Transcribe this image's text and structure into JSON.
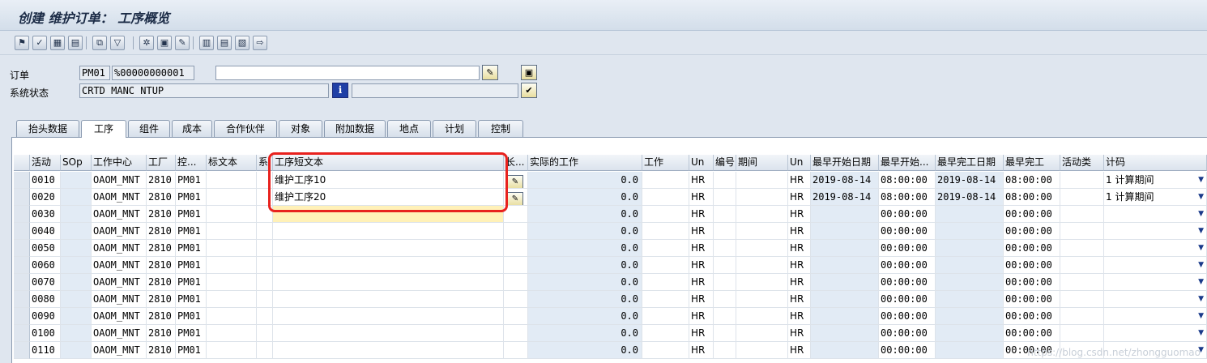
{
  "window": {
    "title": "创建 维护订单： 工序概览"
  },
  "toolbar": {
    "buttons": [
      {
        "name": "header-flag-icon",
        "glyph": "⚑"
      },
      {
        "name": "check-icon",
        "glyph": "✓"
      },
      {
        "name": "table-icon",
        "glyph": "▦"
      },
      {
        "name": "calendar-icon",
        "glyph": "▤"
      },
      {
        "name": "hierarchy-icon",
        "glyph": "⧉"
      },
      {
        "name": "filter-icon",
        "glyph": "▽"
      },
      {
        "name": "network-icon",
        "glyph": "✲"
      },
      {
        "name": "document-icon",
        "glyph": "▣"
      },
      {
        "name": "pencil-icon",
        "glyph": "✎"
      },
      {
        "name": "clipboard-icon",
        "glyph": "▥"
      },
      {
        "name": "print-icon",
        "glyph": "▤"
      },
      {
        "name": "save-list-icon",
        "glyph": "▧"
      },
      {
        "name": "forward-icon",
        "glyph": "⇨"
      }
    ]
  },
  "header": {
    "order_label": "订单",
    "order_type": "PM01",
    "order_number": "%00000000001",
    "order_desc": "",
    "status_label": "系统状态",
    "status_value": "CRTD MANC NTUP",
    "status_extra": ""
  },
  "tabs": [
    "抬头数据",
    "工序",
    "组件",
    "成本",
    "合作伙伴",
    "对象",
    "附加数据",
    "地点",
    "计划",
    "控制"
  ],
  "active_tab": "工序",
  "grid": {
    "columns": [
      "活动",
      "SOp",
      "工作中心",
      "工厂",
      "控...",
      "标文本",
      "系",
      "工序短文本",
      "长...",
      "实际的工作",
      "工作",
      "Un",
      "编号",
      "期间",
      "Un",
      "最早开始日期",
      "最早开始...",
      "最早完工日期",
      "最早完工",
      "活动类",
      "计码"
    ],
    "rows": [
      {
        "act": "0010",
        "wc": "OAOM_MNT",
        "plant": "2810",
        "ctrl": "PM01",
        "text": "维护工序10",
        "longtext": true,
        "actual": "0.0",
        "un1": "HR",
        "un2": "HR",
        "es_date": "2019-08-14",
        "es_time": "08:00:00",
        "ef_date": "2019-08-14",
        "ef_time": "08:00:00",
        "calc": "1 计算期间"
      },
      {
        "act": "0020",
        "wc": "OAOM_MNT",
        "plant": "2810",
        "ctrl": "PM01",
        "text": "维护工序20",
        "longtext": true,
        "actual": "0.0",
        "un1": "HR",
        "un2": "HR",
        "es_date": "2019-08-14",
        "es_time": "08:00:00",
        "ef_date": "2019-08-14",
        "ef_time": "08:00:00",
        "calc": "1 计算期间"
      },
      {
        "act": "0030",
        "wc": "OAOM_MNT",
        "plant": "2810",
        "ctrl": "PM01",
        "text": "",
        "longtext": false,
        "actual": "0.0",
        "un1": "HR",
        "un2": "HR",
        "es_date": "",
        "es_time": "00:00:00",
        "ef_date": "",
        "ef_time": "00:00:00",
        "calc": ""
      },
      {
        "act": "0040",
        "wc": "OAOM_MNT",
        "plant": "2810",
        "ctrl": "PM01",
        "text": "",
        "longtext": false,
        "actual": "0.0",
        "un1": "HR",
        "un2": "HR",
        "es_date": "",
        "es_time": "00:00:00",
        "ef_date": "",
        "ef_time": "00:00:00",
        "calc": ""
      },
      {
        "act": "0050",
        "wc": "OAOM_MNT",
        "plant": "2810",
        "ctrl": "PM01",
        "text": "",
        "longtext": false,
        "actual": "0.0",
        "un1": "HR",
        "un2": "HR",
        "es_date": "",
        "es_time": "00:00:00",
        "ef_date": "",
        "ef_time": "00:00:00",
        "calc": ""
      },
      {
        "act": "0060",
        "wc": "OAOM_MNT",
        "plant": "2810",
        "ctrl": "PM01",
        "text": "",
        "longtext": false,
        "actual": "0.0",
        "un1": "HR",
        "un2": "HR",
        "es_date": "",
        "es_time": "00:00:00",
        "ef_date": "",
        "ef_time": "00:00:00",
        "calc": ""
      },
      {
        "act": "0070",
        "wc": "OAOM_MNT",
        "plant": "2810",
        "ctrl": "PM01",
        "text": "",
        "longtext": false,
        "actual": "0.0",
        "un1": "HR",
        "un2": "HR",
        "es_date": "",
        "es_time": "00:00:00",
        "ef_date": "",
        "ef_time": "00:00:00",
        "calc": ""
      },
      {
        "act": "0080",
        "wc": "OAOM_MNT",
        "plant": "2810",
        "ctrl": "PM01",
        "text": "",
        "longtext": false,
        "actual": "0.0",
        "un1": "HR",
        "un2": "HR",
        "es_date": "",
        "es_time": "00:00:00",
        "ef_date": "",
        "ef_time": "00:00:00",
        "calc": ""
      },
      {
        "act": "0090",
        "wc": "OAOM_MNT",
        "plant": "2810",
        "ctrl": "PM01",
        "text": "",
        "longtext": false,
        "actual": "0.0",
        "un1": "HR",
        "un2": "HR",
        "es_date": "",
        "es_time": "00:00:00",
        "ef_date": "",
        "ef_time": "00:00:00",
        "calc": ""
      },
      {
        "act": "0100",
        "wc": "OAOM_MNT",
        "plant": "2810",
        "ctrl": "PM01",
        "text": "",
        "longtext": false,
        "actual": "0.0",
        "un1": "HR",
        "un2": "HR",
        "es_date": "",
        "es_time": "00:00:00",
        "ef_date": "",
        "ef_time": "00:00:00",
        "calc": ""
      },
      {
        "act": "0110",
        "wc": "OAOM_MNT",
        "plant": "2810",
        "ctrl": "PM01",
        "text": "",
        "longtext": false,
        "actual": "0.0",
        "un1": "HR",
        "un2": "HR",
        "es_date": "",
        "es_time": "00:00:00",
        "ef_date": "",
        "ef_time": "00:00:00",
        "calc": ""
      }
    ]
  },
  "watermark": "https://blog.csdn.net/zhongguomao"
}
